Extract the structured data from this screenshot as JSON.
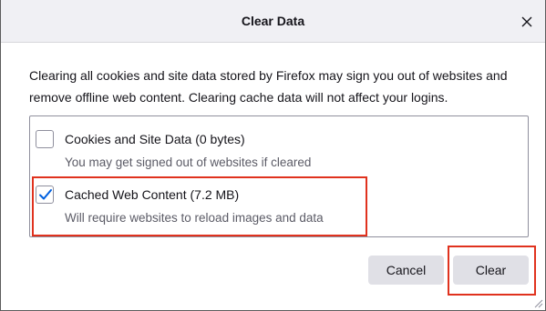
{
  "dialog": {
    "title": "Clear Data",
    "close_icon": "close-icon",
    "description": "Clearing all cookies and site data stored by Firefox may sign you out of websites and remove offline web content. Clearing cache data will not affect your logins."
  },
  "options": [
    {
      "label": "Cookies and Site Data (0 bytes)",
      "description": "You may get signed out of websites if cleared",
      "checked": false
    },
    {
      "label": "Cached Web Content (7.2 MB)",
      "description": "Will require websites to reload images and data",
      "checked": true
    }
  ],
  "buttons": {
    "cancel": "Cancel",
    "clear": "Clear"
  },
  "colors": {
    "accent": "#0060df",
    "highlight": "#e0321e",
    "button_bg": "#e0e0e6",
    "titlebar_bg": "#f0f0f4"
  }
}
